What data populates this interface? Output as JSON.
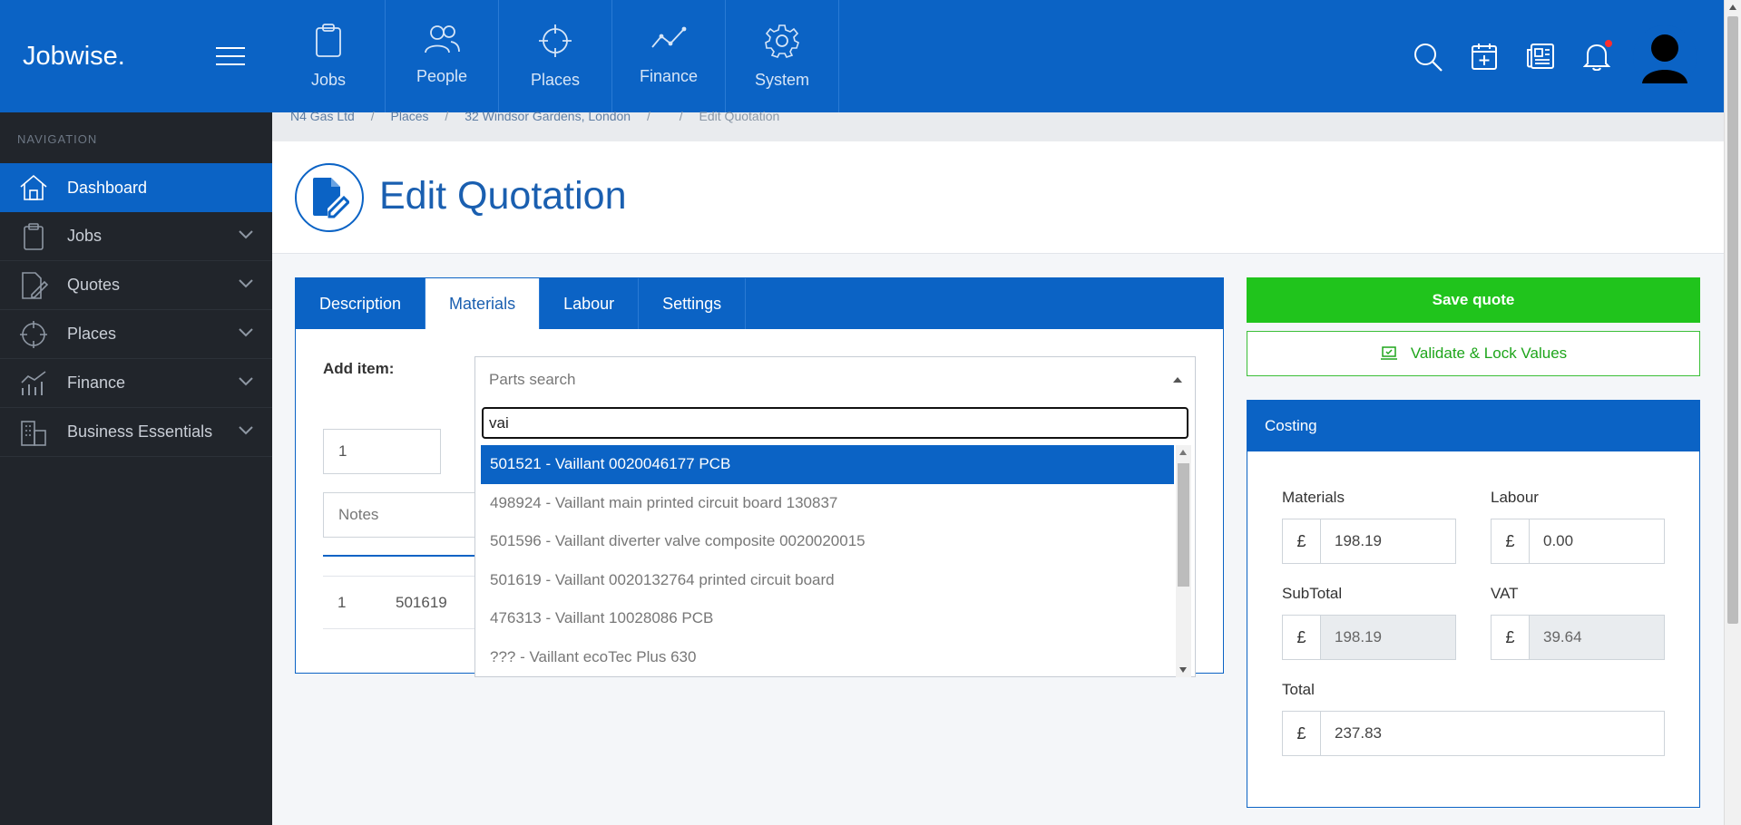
{
  "app": {
    "brand": "Jobwise."
  },
  "sidebar": {
    "heading": "NAVIGATION",
    "items": [
      {
        "label": "Dashboard",
        "icon": "home-icon",
        "active": true
      },
      {
        "label": "Jobs",
        "icon": "clipboard-icon"
      },
      {
        "label": "Quotes",
        "icon": "document-edit-icon"
      },
      {
        "label": "Places",
        "icon": "crosshair-icon"
      },
      {
        "label": "Finance",
        "icon": "chart-icon"
      },
      {
        "label": "Business Essentials",
        "icon": "buildings-icon"
      }
    ]
  },
  "topnav": {
    "tabs": [
      {
        "label": "Jobs",
        "icon": "clipboard-icon"
      },
      {
        "label": "People",
        "icon": "people-icon"
      },
      {
        "label": "Places",
        "icon": "crosshair-icon"
      },
      {
        "label": "Finance",
        "icon": "line-chart-icon"
      },
      {
        "label": "System",
        "icon": "gear-icon"
      }
    ],
    "icons": [
      "search-icon",
      "calendar-add-icon",
      "newspaper-icon",
      "bell-icon",
      "avatar"
    ]
  },
  "breadcrumb": {
    "items": [
      "N4 Gas Ltd",
      "Places",
      "32 Windsor Gardens, London",
      "",
      "Edit Quotation"
    ]
  },
  "page": {
    "title": "Edit Quotation"
  },
  "quote": {
    "tabs": [
      "Description",
      "Materials",
      "Labour",
      "Settings"
    ],
    "active_tab": "Materials",
    "add_item_label": "Add item:",
    "quantity_value": "1",
    "notes_placeholder": "Notes",
    "row": {
      "qty": "1",
      "code": "501619"
    }
  },
  "parts_select": {
    "placeholder": "Parts search",
    "search_value": "vai",
    "options": [
      "501521 - Vaillant 0020046177 PCB",
      "498924 - Vaillant main printed circuit board 130837",
      "501596 - Vaillant diverter valve composite 0020020015",
      "501619 - Vaillant 0020132764 printed circuit board",
      "476313 - Vaillant 10028086 PCB",
      "??? - Vaillant ecoTec Plus 630"
    ],
    "highlighted_index": 0
  },
  "actions": {
    "save_label": "Save quote",
    "validate_label": "Validate & Lock Values"
  },
  "costing": {
    "title": "Costing",
    "currency": "£",
    "materials_label": "Materials",
    "materials_value": "198.19",
    "labour_label": "Labour",
    "labour_value": "0.00",
    "subtotal_label": "SubTotal",
    "subtotal_value": "198.19",
    "vat_label": "VAT",
    "vat_value": "39.64",
    "total_label": "Total",
    "total_value": "237.83"
  },
  "colors": {
    "primary": "#0b63c5",
    "sidebar": "#21252b",
    "success": "#20c41c",
    "notification": "#ff2d2d"
  }
}
